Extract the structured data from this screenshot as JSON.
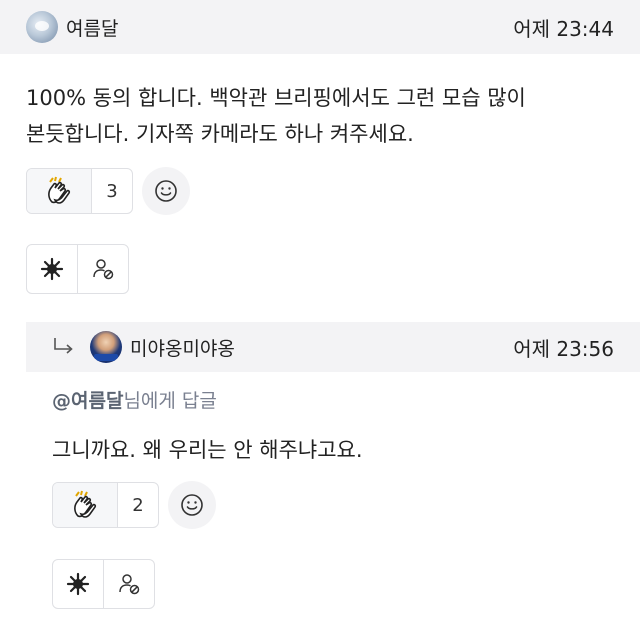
{
  "comment": {
    "username": "여름달",
    "time": "어제 23:44",
    "text_line1": "100% 동의 합니다. 백악관 브리핑에서도 그런 모습 많이",
    "text_line2": "본듯합니다. 기자쪽 카메라도 하나 켜주세요.",
    "reaction_emoji": "clap-hands-emoji",
    "reaction_count": "3"
  },
  "reply": {
    "username": "미야옹미야옹",
    "time": "어제 23:56",
    "mention_name": "@여름달",
    "mention_suffix": "님에게 답글",
    "text": "그니까요. 왜 우리는 안 해주냐고요.",
    "reaction_emoji": "clap-hands-emoji",
    "reaction_count": "2"
  },
  "icons": {
    "add_reaction": "smiley-icon",
    "award": "award-burst-icon",
    "block_user": "block-user-icon",
    "reply_arrow": "reply-arrow-icon"
  },
  "colors": {
    "header_bg": "#f3f3f5",
    "border": "#dfe0e4",
    "muted_text": "#7a8090"
  }
}
